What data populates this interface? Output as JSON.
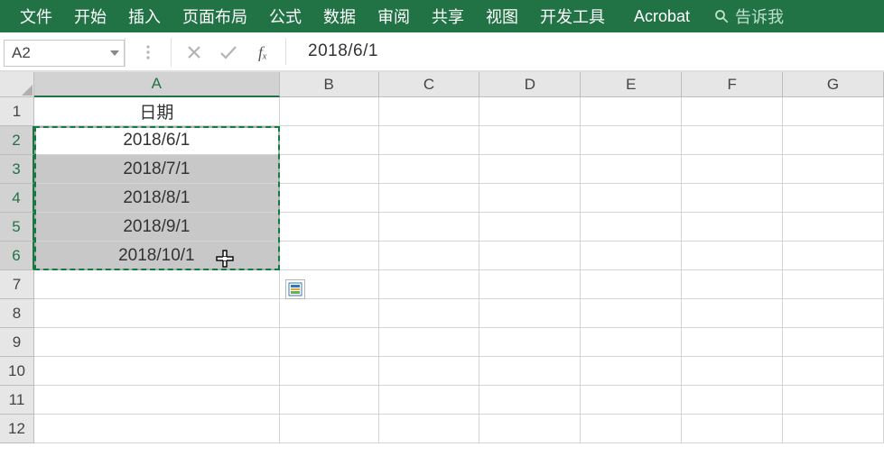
{
  "ribbon": {
    "tabs": [
      "文件",
      "开始",
      "插入",
      "页面布局",
      "公式",
      "数据",
      "审阅",
      "共享",
      "视图",
      "开发工具",
      "Acrobat"
    ],
    "tell_me": "告诉我"
  },
  "fxbar": {
    "namebox": "A2",
    "fx_symbol": "fₓ",
    "formula": "2018/6/1"
  },
  "columns": [
    "A",
    "B",
    "C",
    "D",
    "E",
    "F",
    "G"
  ],
  "rows": [
    "1",
    "2",
    "3",
    "4",
    "5",
    "6",
    "7",
    "8",
    "9",
    "10",
    "11",
    "12"
  ],
  "cells": {
    "A1": "日期",
    "A2": "2018/6/1",
    "A3": "2018/7/1",
    "A4": "2018/8/1",
    "A5": "2018/9/1",
    "A6": "2018/10/1"
  },
  "selection": {
    "active_cell": "A2",
    "range": "A2:A6",
    "selected_column": "A",
    "selected_rows": [
      "2",
      "3",
      "4",
      "5",
      "6"
    ]
  },
  "chart_data": null
}
